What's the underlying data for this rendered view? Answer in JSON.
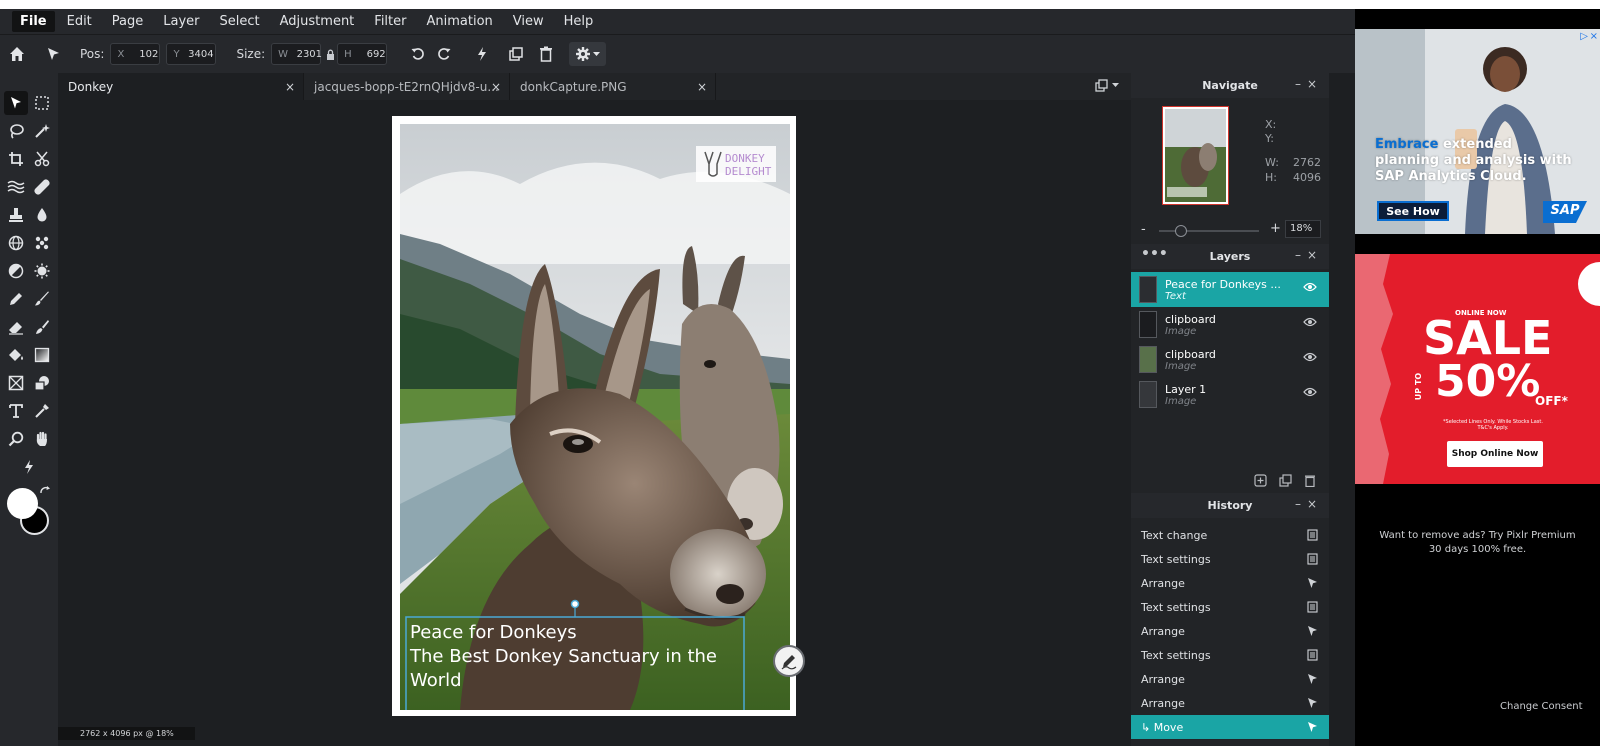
{
  "menu": [
    "File",
    "Edit",
    "Page",
    "Layer",
    "Select",
    "Adjustment",
    "Filter",
    "Animation",
    "View",
    "Help"
  ],
  "toolbar": {
    "pos_label": "Pos:",
    "x_label": "X",
    "x_value": "102",
    "y_label": "Y",
    "y_value": "3404",
    "size_label": "Size:",
    "w_label": "W",
    "w_value": "2301",
    "h_label": "H",
    "h_value": "692"
  },
  "tabs": [
    {
      "label": "Donkey",
      "close": "×"
    },
    {
      "label": "jacques-bopp-tE2rnQHjdv8-u...",
      "close": "×"
    },
    {
      "label": "donkCapture.PNG",
      "close": "×"
    }
  ],
  "canvas": {
    "logo_line1": "DONKEY",
    "logo_line2": "DELIGHT",
    "text_line1": "Peace for Donkeys",
    "text_line2": "The Best Donkey Sanctuary in the",
    "text_line3": "World"
  },
  "status": "2762 x 4096 px @ 18%",
  "navigate": {
    "title": "Navigate",
    "x_label": "X:",
    "y_label": "Y:",
    "w_label": "W:",
    "w_value": "2762",
    "h_label": "H:",
    "h_value": "4096",
    "zoom_minus": "-",
    "zoom_plus": "+",
    "zoom_value": "18%",
    "zoom_fraction": 0.18
  },
  "layers": {
    "title": "Layers",
    "items": [
      {
        "name": "Peace for Donkeys ...",
        "type": "Text"
      },
      {
        "name": "clipboard",
        "type": "Image"
      },
      {
        "name": "clipboard",
        "type": "Image"
      },
      {
        "name": "Layer 1",
        "type": "Image"
      }
    ]
  },
  "history": {
    "title": "History",
    "items": [
      "Text change",
      "Text settings",
      "Arrange",
      "Text settings",
      "Arrange",
      "Text settings",
      "Arrange",
      "Arrange",
      "↳ Move"
    ]
  },
  "ads": {
    "sap_highlight": "Embrace",
    "sap_rest": " extended planning and analysis with SAP Analytics Cloud.",
    "sap_cta": "See How",
    "sap_logo": "SAP",
    "sale_top": "ONLINE NOW",
    "sale_big": "SALE",
    "sale_upto": "UP TO",
    "sale_pct": "50%",
    "sale_off": "OFF*",
    "sale_fine": "*Selected Lines Only. While Stocks Last. T&C's Apply.",
    "sale_cta": "Shop Online Now",
    "premium_text": "Want to remove ads? Try Pixlr Premium 30 days 100% free.",
    "consent": "Change Consent"
  },
  "colors": {
    "accent": "#1aa5a5",
    "bg": "#1d1f22",
    "panel": "#26282c",
    "sap_blue": "#0a6ed1",
    "sale_red": "#e31d2b"
  }
}
